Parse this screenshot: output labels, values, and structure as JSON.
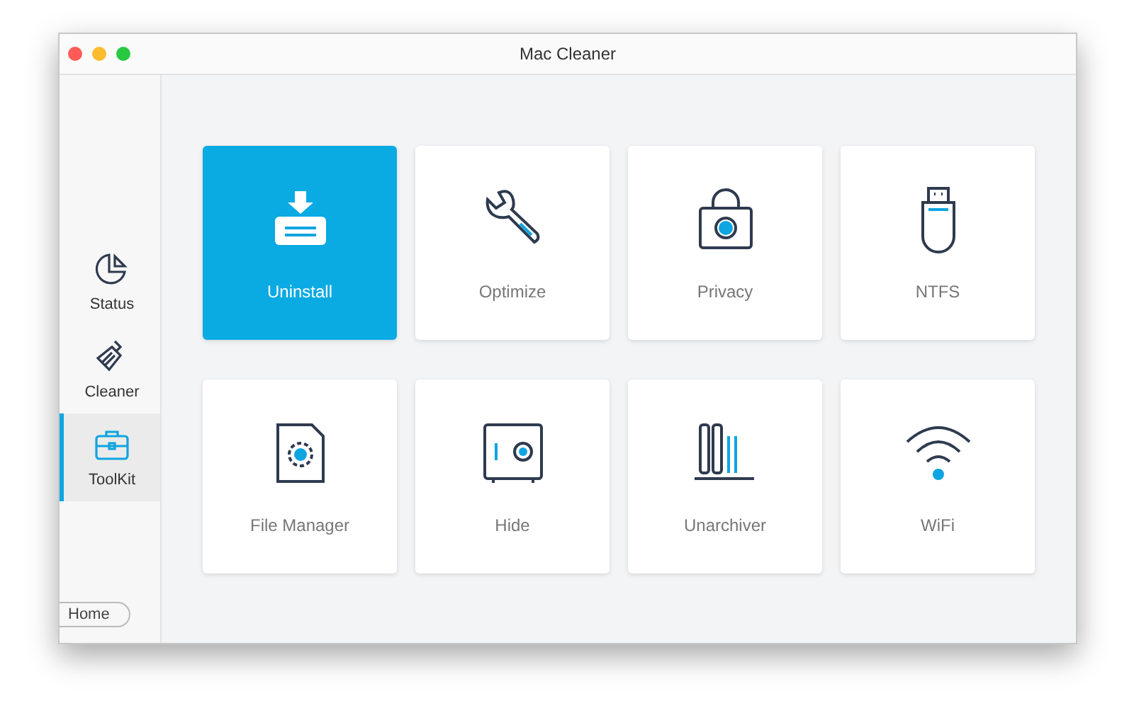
{
  "window": {
    "title": "Mac Cleaner"
  },
  "sidebar": {
    "items": [
      {
        "kind": "status",
        "label": "Status",
        "selected": false
      },
      {
        "kind": "cleaner",
        "label": "Cleaner",
        "selected": false
      },
      {
        "kind": "toolkit",
        "label": "ToolKit",
        "selected": true
      }
    ],
    "home_button": "Home"
  },
  "tools": [
    {
      "kind": "uninstall",
      "label": "Uninstall",
      "selected": true
    },
    {
      "kind": "optimize",
      "label": "Optimize",
      "selected": false
    },
    {
      "kind": "privacy",
      "label": "Privacy",
      "selected": false
    },
    {
      "kind": "ntfs",
      "label": "NTFS",
      "selected": false
    },
    {
      "kind": "file_manager",
      "label": "File Manager",
      "selected": false
    },
    {
      "kind": "hide",
      "label": "Hide",
      "selected": false
    },
    {
      "kind": "unarchiver",
      "label": "Unarchiver",
      "selected": false
    },
    {
      "kind": "wifi",
      "label": "WiFi",
      "selected": false
    }
  ]
}
